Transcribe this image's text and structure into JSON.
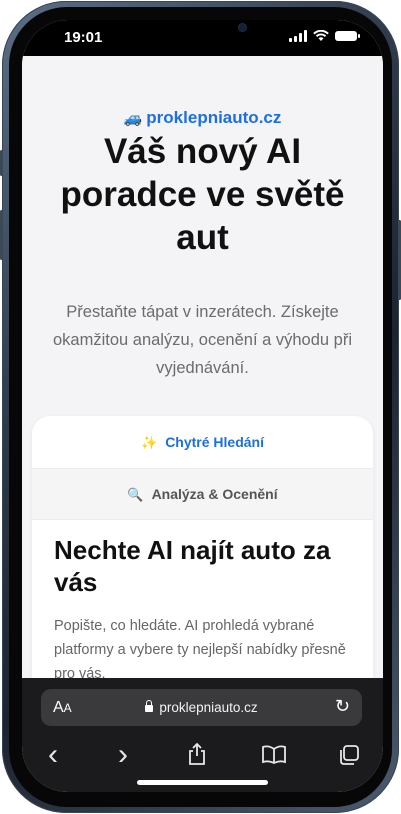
{
  "status_bar": {
    "time": "19:01"
  },
  "page": {
    "brand_icon": "🚙",
    "brand": "proklepniauto.cz",
    "headline": "Váš nový AI poradce ve světě aut",
    "subtext": "Přestaňte tápat v inzerátech. Získejte okamžitou analýzu, ocenění a výhodu při vyjednávání.",
    "tabs": [
      {
        "icon": "✨",
        "label": "Chytré Hledání"
      },
      {
        "icon": "🔍",
        "label": "Analýza & Ocenění"
      }
    ],
    "card_title": "Nechte AI najít auto za vás",
    "card_text": "Popište, co hledáte. AI prohledá vybrané platformy a vybere ty nejlepší nabídky přesně pro vás."
  },
  "browser": {
    "aa_label_small": "A",
    "aa_label_big": "A",
    "url": "proklepniauto.cz",
    "reload_icon": "↻",
    "toolbar": {
      "back_icon": "‹",
      "forward_icon": "›",
      "share_icon": "⇪",
      "bookmarks_icon": "📖",
      "tabs_icon": "⧉"
    }
  },
  "colors": {
    "accent": "#1d6fe0",
    "page_bg": "#f4f4f6",
    "toolbar_bg": "#1b1b1d"
  }
}
